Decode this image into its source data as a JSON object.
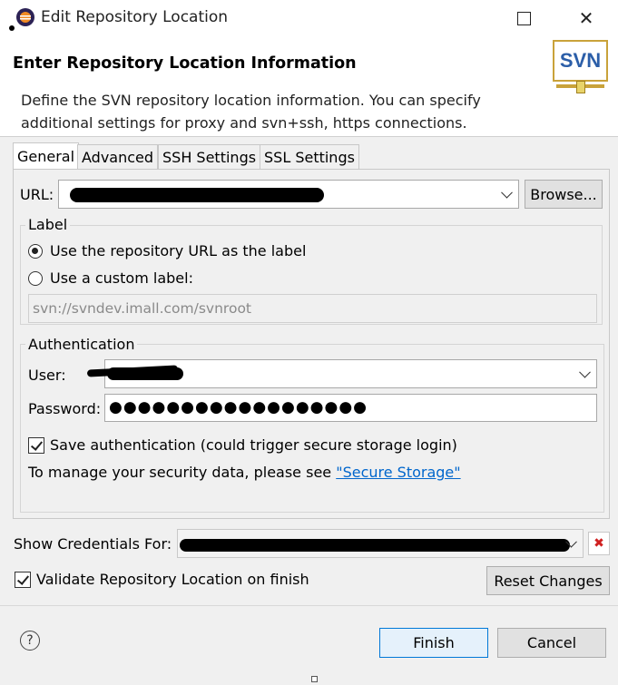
{
  "window": {
    "title": "Edit Repository Location"
  },
  "header": {
    "title": "Enter Repository Location Information",
    "description": "Define the SVN repository location information. You can specify additional settings for proxy and svn+ssh, https connections.",
    "logo_text": "SVN"
  },
  "tabs": [
    {
      "label": "General",
      "active": true
    },
    {
      "label": "Advanced"
    },
    {
      "label": "SSH Settings"
    },
    {
      "label": "SSL Settings"
    }
  ],
  "url": {
    "label": "URL:",
    "browse_label": "Browse..."
  },
  "label_group": {
    "title": "Label",
    "use_repo_url": "Use the repository URL as the label",
    "use_custom": "Use a custom label:",
    "custom_value": "svn://svndev.imall.com/svnroot"
  },
  "auth_group": {
    "title": "Authentication",
    "user_label": "User:",
    "password_label": "Password:",
    "password_mask": "●●●●●●●●●●●●●●●●●●",
    "save_auth": "Save authentication (could trigger secure storage login)",
    "manage_text": "To manage your security data, please see ",
    "secure_storage_link": "\"Secure Storage\""
  },
  "credentials": {
    "label": "Show Credentials For:"
  },
  "validate": {
    "label": "Validate Repository Location on finish",
    "checked": true
  },
  "buttons": {
    "reset": "Reset Changes",
    "finish": "Finish",
    "cancel": "Cancel",
    "help": "?"
  },
  "colors": {
    "accent": "#0066cc",
    "logo_blue": "#2b5ea8",
    "delete_red": "#d02020"
  }
}
